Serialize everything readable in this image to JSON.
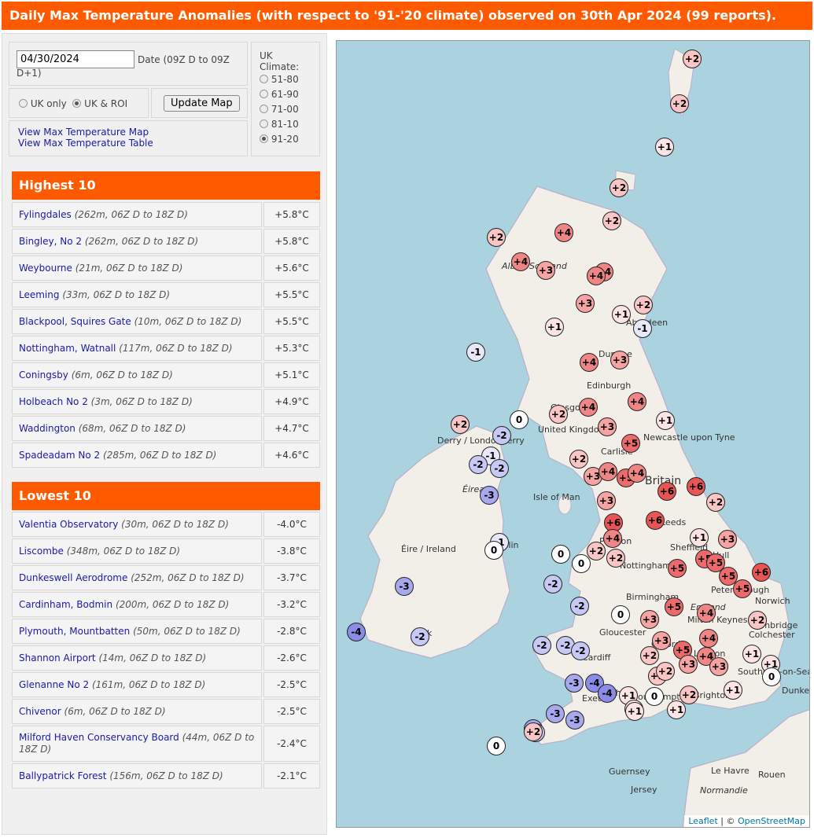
{
  "header": {
    "title": "Daily Max Temperature Anomalies (with respect to '91-'20 climate) observed on 30th Apr 2024 (99 reports)."
  },
  "controls": {
    "date_value": "04/30/2024",
    "date_label": "Date (09Z D to 09Z D+1)",
    "region_uk_only": "UK only",
    "region_uk_roi": "UK & ROI",
    "update_button": "Update Map",
    "link_map": "View Max Temperature Map",
    "link_table": "View Max Temperature Table",
    "climate_title": "UK Climate:",
    "climate_options": [
      "51-80",
      "61-90",
      "71-00",
      "81-10",
      "91-20"
    ],
    "climate_selected": "91-20"
  },
  "highest": {
    "title": "Highest 10",
    "rows": [
      {
        "name": "Fylingdales",
        "detail": "(262m, 06Z D to 18Z D)",
        "value": "+5.8°C"
      },
      {
        "name": "Bingley, No 2",
        "detail": "(262m, 06Z D to 18Z D)",
        "value": "+5.8°C"
      },
      {
        "name": "Weybourne",
        "detail": "(21m, 06Z D to 18Z D)",
        "value": "+5.6°C"
      },
      {
        "name": "Leeming",
        "detail": "(33m, 06Z D to 18Z D)",
        "value": "+5.5°C"
      },
      {
        "name": "Blackpool, Squires Gate",
        "detail": "(10m, 06Z D to 18Z D)",
        "value": "+5.5°C"
      },
      {
        "name": "Nottingham, Watnall",
        "detail": "(117m, 06Z D to 18Z D)",
        "value": "+5.3°C"
      },
      {
        "name": "Coningsby",
        "detail": "(6m, 06Z D to 18Z D)",
        "value": "+5.1°C"
      },
      {
        "name": "Holbeach No 2",
        "detail": "(3m, 06Z D to 18Z D)",
        "value": "+4.9°C"
      },
      {
        "name": "Waddington",
        "detail": "(68m, 06Z D to 18Z D)",
        "value": "+4.7°C"
      },
      {
        "name": "Spadeadam No 2",
        "detail": "(285m, 06Z D to 18Z D)",
        "value": "+4.6°C"
      }
    ]
  },
  "lowest": {
    "title": "Lowest 10",
    "rows": [
      {
        "name": "Valentia Observatory",
        "detail": "(30m, 06Z D to 18Z D)",
        "value": "-4.0°C"
      },
      {
        "name": "Liscombe",
        "detail": "(348m, 06Z D to 18Z D)",
        "value": "-3.8°C"
      },
      {
        "name": "Dunkeswell Aerodrome",
        "detail": "(252m, 06Z D to 18Z D)",
        "value": "-3.7°C"
      },
      {
        "name": "Cardinham, Bodmin",
        "detail": "(200m, 06Z D to 18Z D)",
        "value": "-3.2°C"
      },
      {
        "name": "Plymouth, Mountbatten",
        "detail": "(50m, 06Z D to 18Z D)",
        "value": "-2.8°C"
      },
      {
        "name": "Shannon Airport",
        "detail": "(14m, 06Z D to 18Z D)",
        "value": "-2.6°C"
      },
      {
        "name": "Glenanne No 2",
        "detail": "(161m, 06Z D to 18Z D)",
        "value": "-2.5°C"
      },
      {
        "name": "Chivenor",
        "detail": "(6m, 06Z D to 18Z D)",
        "value": "-2.5°C"
      },
      {
        "name": "Milford Haven Conservancy Board",
        "detail": "(44m, 06Z D to 18Z D)",
        "value": "-2.4°C"
      },
      {
        "name": "Ballypatrick Forest",
        "detail": "(156m, 06Z D to 18Z D)",
        "value": "-2.1°C"
      }
    ]
  },
  "map": {
    "attribution_leaflet": "Leaflet",
    "attribution_sep": " | © ",
    "attribution_osm": "OpenStreetMap",
    "colors": {
      "sea": "#aad3df",
      "land": "#f2efe9",
      "neutral": "#ffffff",
      "warm1": "#fde4e4",
      "warm2": "#f9c5c5",
      "warm3": "#f5a3a3",
      "warm4": "#f08585",
      "warm5": "#ec6a6a",
      "warm6": "#e85555",
      "cool1": "#e8e8fb",
      "cool2": "#c8c8f5",
      "cool3": "#a8a8ee",
      "cool4": "#8c8ce6"
    },
    "place_labels": [
      "Aberdeen",
      "Dundee",
      "Edinburgh",
      "Glasgow",
      "United Kingdom",
      "Newcastle upon Tyne",
      "Carlisle",
      "Britain",
      "Derry / Londonderry",
      "Éireann",
      "Isle of Man",
      "Éire / Ireland",
      "Leeds",
      "Preston",
      "Sheffield",
      "Hull",
      "Nottingham",
      "Birmingham",
      "Peterborough",
      "Norwich",
      "Cambridge",
      "Colchester",
      "England",
      "Gloucester",
      "Oxford",
      "London",
      "Cardiff",
      "Bath",
      "Southend-on-Sea",
      "Brighton",
      "Exeter",
      "Southampton",
      "Dunkerque",
      "Guernsey",
      "Jersey",
      "Le Havre",
      "Rouen",
      "Normandie",
      "Alba / Scotland",
      "Cork",
      "Dublin",
      "Milton Keynes"
    ],
    "markers": [
      {
        "label": "+2",
        "c": "warm2"
      },
      {
        "label": "+2",
        "c": "warm2"
      },
      {
        "label": "+1",
        "c": "warm1"
      },
      {
        "label": "+2",
        "c": "warm2"
      },
      {
        "label": "+2",
        "c": "warm2"
      },
      {
        "label": "+2",
        "c": "warm2"
      },
      {
        "label": "+4",
        "c": "warm4"
      },
      {
        "label": "+4",
        "c": "warm4"
      },
      {
        "label": "+3",
        "c": "warm3"
      },
      {
        "label": "+4",
        "c": "warm4"
      },
      {
        "label": "+4",
        "c": "warm4"
      },
      {
        "label": "+3",
        "c": "warm3"
      },
      {
        "label": "+1",
        "c": "warm1"
      },
      {
        "label": "+2",
        "c": "warm2"
      },
      {
        "label": "+1",
        "c": "warm1"
      },
      {
        "label": "-1",
        "c": "cool1"
      },
      {
        "label": "-1",
        "c": "cool1"
      },
      {
        "label": "+4",
        "c": "warm4"
      },
      {
        "label": "+3",
        "c": "warm3"
      },
      {
        "label": "+4",
        "c": "warm4"
      },
      {
        "label": "+4",
        "c": "warm4"
      },
      {
        "label": "+2",
        "c": "warm2"
      },
      {
        "label": "+3",
        "c": "warm3"
      },
      {
        "label": "+1",
        "c": "warm1"
      },
      {
        "label": "+5",
        "c": "warm5"
      },
      {
        "label": "+2",
        "c": "warm2"
      },
      {
        "label": "0",
        "c": "neutral"
      },
      {
        "label": "-2",
        "c": "cool2"
      },
      {
        "label": "-1",
        "c": "cool1"
      },
      {
        "label": "-2",
        "c": "cool2"
      },
      {
        "label": "-2",
        "c": "cool2"
      },
      {
        "label": "-3",
        "c": "cool3"
      },
      {
        "label": "+2",
        "c": "warm2"
      },
      {
        "label": "+3",
        "c": "warm3"
      },
      {
        "label": "+4",
        "c": "warm4"
      },
      {
        "label": "+5",
        "c": "warm5"
      },
      {
        "label": "+4",
        "c": "warm4"
      },
      {
        "label": "+3",
        "c": "warm3"
      },
      {
        "label": "+6",
        "c": "warm6"
      },
      {
        "label": "+6",
        "c": "warm6"
      },
      {
        "label": "+2",
        "c": "warm2"
      },
      {
        "label": "+6",
        "c": "warm6"
      },
      {
        "label": "+6",
        "c": "warm6"
      },
      {
        "label": "+1",
        "c": "warm1"
      },
      {
        "label": "+4",
        "c": "warm4"
      },
      {
        "label": "+3",
        "c": "warm3"
      },
      {
        "label": "-1",
        "c": "cool1"
      },
      {
        "label": "0",
        "c": "neutral"
      },
      {
        "label": "0",
        "c": "neutral"
      },
      {
        "label": "0",
        "c": "neutral"
      },
      {
        "label": "+2",
        "c": "warm2"
      },
      {
        "label": "+2",
        "c": "warm2"
      },
      {
        "label": "+5",
        "c": "warm5"
      },
      {
        "label": "+5",
        "c": "warm5"
      },
      {
        "label": "+5",
        "c": "warm5"
      },
      {
        "label": "+5",
        "c": "warm5"
      },
      {
        "label": "+6",
        "c": "warm6"
      },
      {
        "label": "+5",
        "c": "warm5"
      },
      {
        "label": "-2",
        "c": "cool2"
      },
      {
        "label": "-3",
        "c": "cool3"
      },
      {
        "label": "-2",
        "c": "cool2"
      },
      {
        "label": "0",
        "c": "neutral"
      },
      {
        "label": "+5",
        "c": "warm5"
      },
      {
        "label": "+4",
        "c": "warm4"
      },
      {
        "label": "+3",
        "c": "warm3"
      },
      {
        "label": "+3",
        "c": "warm3"
      },
      {
        "label": "+2",
        "c": "warm2"
      },
      {
        "label": "-4",
        "c": "cool4"
      },
      {
        "label": "-2",
        "c": "cool2"
      },
      {
        "label": "-2",
        "c": "cool2"
      },
      {
        "label": "-2",
        "c": "cool2"
      },
      {
        "label": "-2",
        "c": "cool2"
      },
      {
        "label": "+4",
        "c": "warm4"
      },
      {
        "label": "+2",
        "c": "warm2"
      },
      {
        "label": "+5",
        "c": "warm5"
      },
      {
        "label": "+4",
        "c": "warm4"
      },
      {
        "label": "+3",
        "c": "warm3"
      },
      {
        "label": "+1",
        "c": "warm1"
      },
      {
        "label": "+1",
        "c": "warm1"
      },
      {
        "label": "0",
        "c": "neutral"
      },
      {
        "label": "+3",
        "c": "warm3"
      },
      {
        "label": "+2",
        "c": "warm2"
      },
      {
        "label": "+2",
        "c": "warm2"
      },
      {
        "label": "-3",
        "c": "cool3"
      },
      {
        "label": "-4",
        "c": "cool4"
      },
      {
        "label": "-4",
        "c": "cool4"
      },
      {
        "label": "+1",
        "c": "warm1"
      },
      {
        "label": "0",
        "c": "neutral"
      },
      {
        "label": "+2",
        "c": "warm2"
      },
      {
        "label": "+1",
        "c": "warm1"
      },
      {
        "label": "+1",
        "c": "warm1"
      },
      {
        "label": "+1",
        "c": "warm1"
      },
      {
        "label": "-3",
        "c": "cool3"
      },
      {
        "label": "-3",
        "c": "cool3"
      },
      {
        "label": "-3",
        "c": "cool3"
      },
      {
        "label": "-2",
        "c": "cool2"
      },
      {
        "label": "0",
        "c": "neutral"
      },
      {
        "label": "+2",
        "c": "warm2"
      },
      {
        "label": "+1",
        "c": "warm1"
      }
    ]
  }
}
